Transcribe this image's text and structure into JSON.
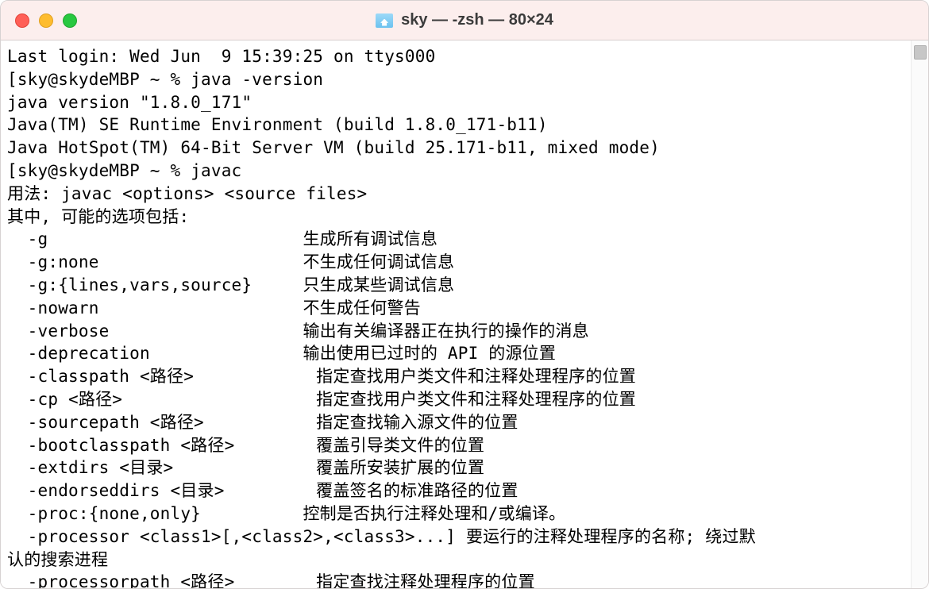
{
  "window": {
    "title": "sky — -zsh — 80×24"
  },
  "session": {
    "last_login": "Last login: Wed Jun  9 15:39:25 on ttys000",
    "prompt": "sky@skydeMBP ~ % ",
    "cmd1": "java -version",
    "java_version": "java version \"1.8.0_171\"",
    "java_runtime": "Java(TM) SE Runtime Environment (build 1.8.0_171-b11)",
    "java_hotspot": "Java HotSpot(TM) 64-Bit Server VM (build 25.171-b11, mixed mode)",
    "cmd2": "javac",
    "usage": "用法: javac <options> <source files>",
    "where": "其中, 可能的选项包括:"
  },
  "options": [
    {
      "flag": "  -g                         ",
      "desc": "生成所有调试信息"
    },
    {
      "flag": "  -g:none                    ",
      "desc": "不生成任何调试信息"
    },
    {
      "flag": "  -g:{lines,vars,source}     ",
      "desc": "只生成某些调试信息"
    },
    {
      "flag": "  -nowarn                    ",
      "desc": "不生成任何警告"
    },
    {
      "flag": "  -verbose                   ",
      "desc": "输出有关编译器正在执行的操作的消息"
    },
    {
      "flag": "  -deprecation               ",
      "desc": "输出使用已过时的 API 的源位置"
    },
    {
      "flag": "  -classpath <路径>            ",
      "desc": "指定查找用户类文件和注释处理程序的位置"
    },
    {
      "flag": "  -cp <路径>                   ",
      "desc": "指定查找用户类文件和注释处理程序的位置"
    },
    {
      "flag": "  -sourcepath <路径>           ",
      "desc": "指定查找输入源文件的位置"
    },
    {
      "flag": "  -bootclasspath <路径>        ",
      "desc": "覆盖引导类文件的位置"
    },
    {
      "flag": "  -extdirs <目录>              ",
      "desc": "覆盖所安装扩展的位置"
    },
    {
      "flag": "  -endorseddirs <目录>         ",
      "desc": "覆盖签名的标准路径的位置"
    },
    {
      "flag": "  -proc:{none,only}          ",
      "desc": "控制是否执行注释处理和/或编译。"
    },
    {
      "flag": "  -processor <class1>[,<class2>,<class3>...] ",
      "desc": "要运行的注释处理程序的名称; 绕过默"
    }
  ],
  "wrap_line": "认的搜索进程",
  "last_option": {
    "flag": "  -processorpath <路径>        ",
    "desc": "指定查找注释处理程序的位置"
  }
}
